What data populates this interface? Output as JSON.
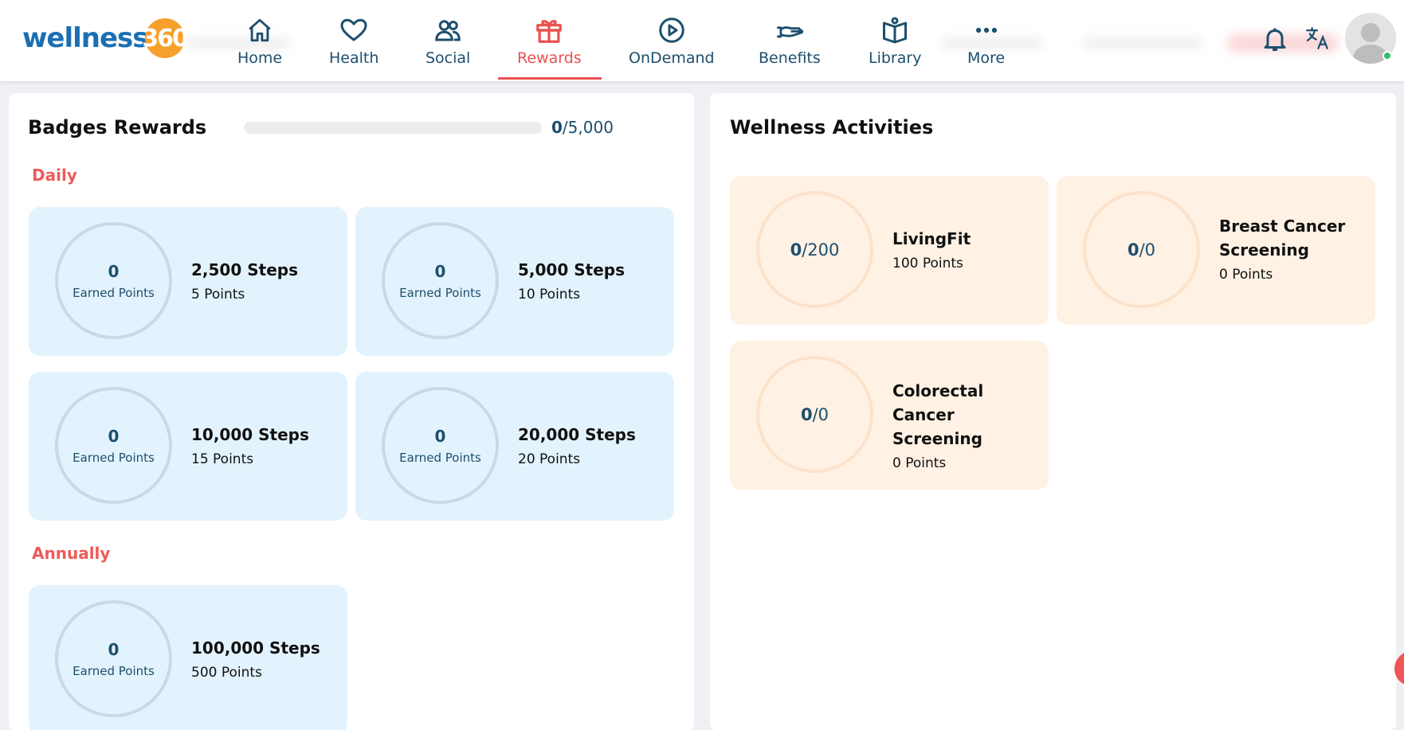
{
  "app": {
    "logo_word": "wellness",
    "logo_badge": "360"
  },
  "nav": {
    "items": [
      {
        "label": "Home",
        "icon": "home-icon"
      },
      {
        "label": "Health",
        "icon": "heart-icon"
      },
      {
        "label": "Social",
        "icon": "users-icon"
      },
      {
        "label": "Rewards",
        "icon": "gift-icon"
      },
      {
        "label": "OnDemand",
        "icon": "play-circle-icon"
      },
      {
        "label": "Benefits",
        "icon": "hand-icon"
      },
      {
        "label": "Library",
        "icon": "book-icon"
      },
      {
        "label": "More",
        "icon": "more-dots-icon"
      }
    ],
    "active": "Rewards"
  },
  "header_icons": [
    "bell-icon",
    "translate-icon",
    "avatar"
  ],
  "colors": {
    "brand": "#1b6fb3",
    "accent": "#e8514f",
    "navy": "#1d4f6e",
    "badge_card": "#e3f3fd",
    "activity_card": "#fff1e4",
    "online": "#2fbf71"
  },
  "badges": {
    "title": "Badges Rewards",
    "progress": {
      "current": "0",
      "total": "/5,000",
      "fraction": 0
    },
    "sections": [
      {
        "label": "Daily",
        "cards": [
          {
            "earned": "0",
            "earned_label": "Earned Points",
            "title": "2,500 Steps",
            "points": "5 Points"
          },
          {
            "earned": "0",
            "earned_label": "Earned Points",
            "title": "5,000 Steps",
            "points": "10 Points"
          },
          {
            "earned": "0",
            "earned_label": "Earned Points",
            "title": "10,000 Steps",
            "points": "15 Points"
          },
          {
            "earned": "0",
            "earned_label": "Earned Points",
            "title": "20,000 Steps",
            "points": "20 Points"
          }
        ]
      },
      {
        "label": "Annually",
        "cards": [
          {
            "earned": "0",
            "earned_label": "Earned Points",
            "title": "100,000 Steps",
            "points": "500 Points"
          }
        ]
      }
    ]
  },
  "activities": {
    "title": "Wellness Activities",
    "cards": [
      {
        "current": "0",
        "total": "/200",
        "title": "LivingFit",
        "points": "100 Points"
      },
      {
        "current": "0",
        "total": "/0",
        "title": "Breast Cancer Screening",
        "points": "0 Points"
      },
      {
        "current": "0",
        "total": "/0",
        "title": "Colorectal Cancer Screening",
        "points": "0 Points"
      }
    ]
  }
}
